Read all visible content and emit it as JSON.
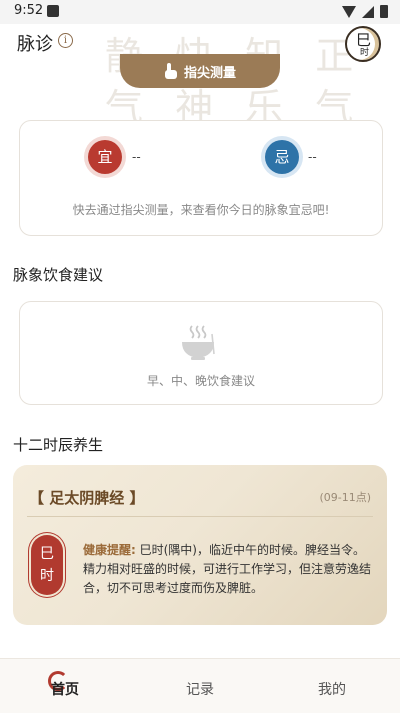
{
  "status_bar": {
    "time": "9:52"
  },
  "background_calligraphy": "静 快 知 正 气 神 乐 气 存 内 不",
  "header": {
    "title": "脉诊",
    "info_icon": "ⓘ",
    "shichen_badge": {
      "char": "巳",
      "label": "时"
    }
  },
  "measure_button": {
    "label": "指尖测量",
    "icon": "hand-pointer-icon"
  },
  "yiji": {
    "yi": {
      "char": "宜",
      "value": "--",
      "color": "#b93a30"
    },
    "ji": {
      "char": "忌",
      "value": "--",
      "color": "#2e73a8"
    },
    "hint": "快去通过指尖测量，来查看你今日的脉象宜忌吧!"
  },
  "diet": {
    "section_title": "脉象饮食建议",
    "hint": "早、中、晚饮食建议",
    "icon": "rice-bowl-icon"
  },
  "shichen": {
    "section_title": "十二时辰养生",
    "meridian": "【 足太阴脾经 】",
    "time_range": "(09-11点)",
    "seal_line1": "巳",
    "seal_line2": "时",
    "advice_label": "健康提醒:",
    "advice_text": " 巳时(隅中)，临近中午的时候。脾经当令。精力相对旺盛的时候，可进行工作学习，但注意劳逸结合，切不可思考过度而伤及脾脏。"
  },
  "bottom_nav": {
    "home": "首页",
    "records": "记录",
    "mine": "我的",
    "accent": "#b13a2f"
  }
}
